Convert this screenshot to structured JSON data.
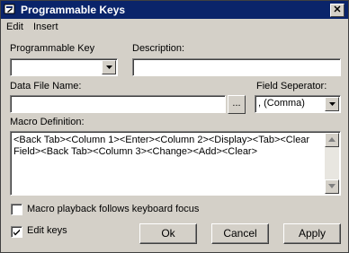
{
  "window": {
    "title": "Programmable Keys",
    "close_label": "✕"
  },
  "menu": {
    "items": [
      "Edit",
      "Insert"
    ]
  },
  "programmable_key": {
    "label": "Programmable Key",
    "value": ""
  },
  "description": {
    "label": "Description:",
    "value": ""
  },
  "data_file": {
    "label": "Data File Name:",
    "value": "",
    "browse_label": "..."
  },
  "field_separator": {
    "label": "Field Seperator:",
    "value": ", (Comma)"
  },
  "macro": {
    "label": "Macro Definition:",
    "value": "<Back Tab><Column 1><Enter><Column 2><Display><Tab><Clear Field><Back Tab><Column 3><Change><Add><Clear>"
  },
  "checkboxes": {
    "playback": {
      "label": "Macro playback follows keyboard focus",
      "checked": false
    },
    "edit_keys": {
      "label": "Edit keys",
      "checked": true
    }
  },
  "buttons": {
    "ok": "Ok",
    "cancel": "Cancel",
    "apply": "Apply"
  }
}
